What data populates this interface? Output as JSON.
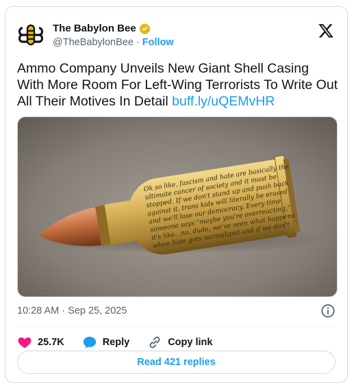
{
  "author": {
    "display_name": "The Babylon Bee",
    "handle": "@TheBabylonBee",
    "separator": " · ",
    "follow_label": "Follow"
  },
  "tweet": {
    "text": "Ammo Company Unveils New Giant Shell Casing With More Room For Left-Wing Terrorists To Write Out All Their Motives In Detail ",
    "link": "buff.ly/uQEMvHR"
  },
  "media": {
    "engraving_lines": [
      "Ok so like, fascism and hate are basically the",
      "ultimate cancer of society and it must be",
      "stopped. If we don't stand up and push back",
      "against it, trans kids will literally be erased",
      "and we'll lose our democracy. Every time",
      "someone says \"maybe you're overreacting,\"",
      "it's like...no, dude, we've seen what happens",
      "when hate gets normalized and if we don't"
    ]
  },
  "meta": {
    "timestamp": "10:28 AM · Sep 25, 2025"
  },
  "actions": {
    "like_count": "25.7K",
    "reply_label": "Reply",
    "copy_link_label": "Copy link"
  },
  "read_replies_label": "Read 421 replies",
  "icons": {
    "logo": "babylon-bee-logo",
    "verified": "verified-badge-icon",
    "x": "x-logo-icon",
    "info": "info-icon",
    "like": "heart-icon",
    "reply": "speech-bubble-icon",
    "copy": "link-icon"
  },
  "colors": {
    "accent": "#1d9bf0",
    "like": "#f91880",
    "verified": "#e2b719",
    "muted": "#536471"
  }
}
